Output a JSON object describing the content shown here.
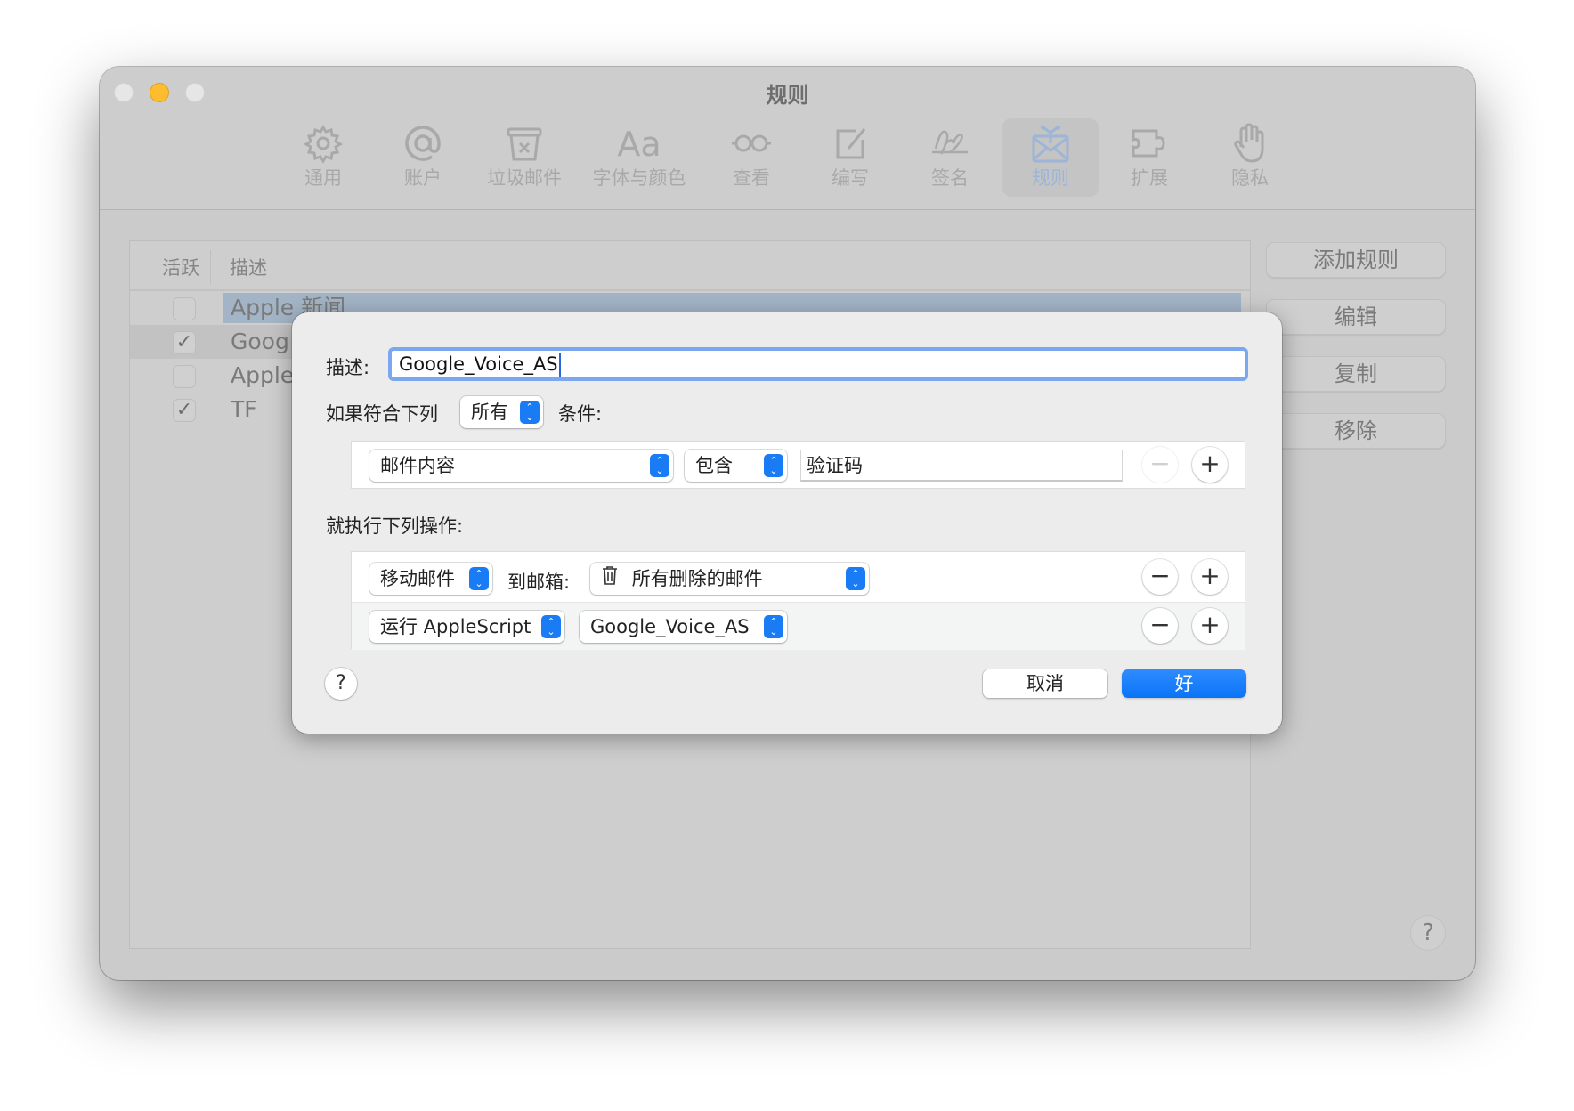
{
  "window": {
    "title": "规则",
    "toolbar": [
      {
        "label": "通用",
        "icon": "gear-icon"
      },
      {
        "label": "账户",
        "icon": "at-icon"
      },
      {
        "label": "垃圾邮件",
        "icon": "junk-bin-icon"
      },
      {
        "label": "字体与颜色",
        "icon": "fonts-icon",
        "glyph": "Aa"
      },
      {
        "label": "查看",
        "icon": "glasses-icon"
      },
      {
        "label": "编写",
        "icon": "compose-icon"
      },
      {
        "label": "签名",
        "icon": "signature-icon"
      },
      {
        "label": "规则",
        "icon": "rules-envelope-icon",
        "selected": true
      },
      {
        "label": "扩展",
        "icon": "puzzle-icon"
      },
      {
        "label": "隐私",
        "icon": "hand-icon"
      }
    ],
    "accent_color": "#1a7cf5"
  },
  "rules_table": {
    "columns": [
      "活跃",
      "描述"
    ],
    "rows": [
      {
        "active": false,
        "description": "Apple 新闻",
        "selected": true
      },
      {
        "active": true,
        "description": "Goog"
      },
      {
        "active": false,
        "description": "Apple"
      },
      {
        "active": true,
        "description": "TF"
      }
    ]
  },
  "side_buttons": [
    "添加规则",
    "编辑",
    "复制",
    "移除"
  ],
  "help_label": "?",
  "check_glyph": "✓",
  "dialog": {
    "description_label": "描述:",
    "description_value": "Google_Voice_AS",
    "if_label": "如果符合下列",
    "match_mode": "所有",
    "conditions_label": "条件:",
    "condition": {
      "field": "邮件内容",
      "operator": "包含",
      "value": "验证码"
    },
    "actions_label": "就执行下列操作:",
    "actions": [
      {
        "action": "移动邮件",
        "to_label": "到邮箱:",
        "mailbox": "所有删除的邮件",
        "mailbox_icon": "trash-icon"
      },
      {
        "action": "运行 AppleScript",
        "script": "Google_Voice_AS"
      }
    ],
    "minus": "−",
    "plus": "+",
    "help": "?",
    "cancel_label": "取消",
    "ok_label": "好"
  }
}
